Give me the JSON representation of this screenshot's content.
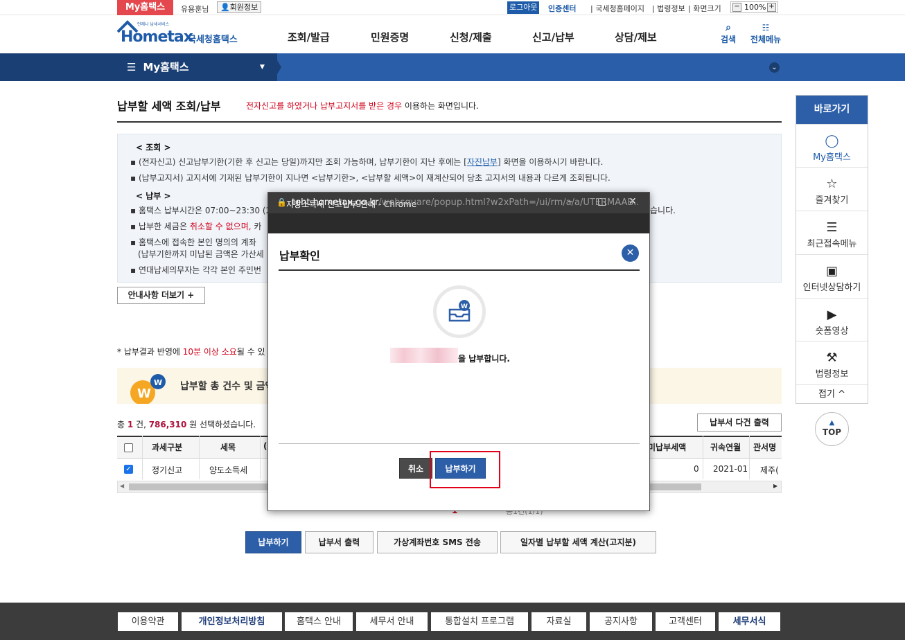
{
  "topbar": {
    "my_tab": "My홈택스",
    "user_greet": "유용훈님",
    "member_info": "회원정보",
    "logout": "로그아웃",
    "cert_center": "인증센터",
    "nts_page": "국세청홈페이지",
    "law_info": "법령정보",
    "screen_size": "화면크기",
    "zoom_value": "100%"
  },
  "header": {
    "logo_sub": "언제나 납세서비스",
    "logo_main": "Hometax",
    "logo_kr": "국세청홈택스",
    "gnb": [
      "조회/발급",
      "민원증명",
      "신청/제출",
      "신고/납부",
      "상담/제보"
    ],
    "search_label": "검색",
    "allmenu_label": "전체메뉴"
  },
  "navbar": {
    "title": "My홈택스"
  },
  "page": {
    "title": "납부할 세액 조회/납부",
    "subtitle_red": "전자신고를 하였거나 납부고지서를 받은 경우",
    "subtitle_rest": " 이용하는 화면입니다."
  },
  "info": {
    "head1": "< 조회 >",
    "line1a": "▪ (전자신고) 신고납부기한(기한 후 신고는 당일)까지만 조회 가능하며, 납부기한이 지난 후에는 [",
    "line1_link": "자진납부",
    "line1b": "] 화면을 이용하시기 바랍니다.",
    "line2": "▪ (납부고지서) 고지서에 기재된 납부기한이 지나면 <납부기한>, <납부할 세액>이 재계산되어 당초 고지서의 내용과 다르게 조회됩니다.",
    "head2": "< 납부 >",
    "line3": "▪ 홈택스 납부시간은 07:00~23:30 (22",
    "line3_tail": "습니다.",
    "line4a": "▪ 납부한 세금은 ",
    "line4_red": "취소할 수 없으며,",
    "line4b": " 카",
    "line5": "▪ 홈택스에 접속한 본인 명의의 계좌",
    "line6": "(납부기한까지 미납된 금액은 가산세",
    "line7": "▪ 연대납세의무자는 각각 본인 주민번"
  },
  "more_button": "안내사항 더보기 +",
  "note": {
    "pre": "* 납부결과 반영에 ",
    "red": "10분 이상 소요",
    "post": "될 수 있"
  },
  "summary": {
    "text": "납부할 총 건수 및 금액"
  },
  "count": {
    "pre": "총 ",
    "cnt": "1",
    "mid": " 건, ",
    "amt": "786,310",
    "post": " 원 선택하셨습니다."
  },
  "bulk_print": "납부서 다건 출력",
  "table": {
    "headers": [
      "과세구분",
      "세목",
      "(",
      "미납부세액",
      "귀속연월",
      "관서명"
    ],
    "row": {
      "type": "정기신고",
      "tax": "양도소득세",
      "unpaid": "0",
      "period": "2021-01",
      "office": "제주("
    }
  },
  "pager": {
    "current": "1",
    "text": "총1건(1/1)"
  },
  "bottom_buttons": [
    "납부하기",
    "납부서 출력",
    "가상계좌번호 SMS 전송",
    "일자별 납부할 세액 계산(고지분)"
  ],
  "footer": [
    "이용약관",
    "개인정보처리방침",
    "홈택스 안내",
    "세무서 안내",
    "통합설치 프로그램",
    "자료실",
    "공지사항",
    "고객센터",
    "세무서식"
  ],
  "quick": {
    "head": "바로가기",
    "items": [
      "My홈택스",
      "즐겨찾기",
      "최근접속메뉴",
      "인터넷상담하기",
      "숏폼영상",
      "법령정보"
    ],
    "fold": "접기 ^",
    "top": "TOP"
  },
  "popup": {
    "window_title": "지방소득세 신고납부 안내 - Chrome",
    "url_host": "teht.hometax.go.kr",
    "url_path": "/websquare/popup.html?w2xPath=/ui/rm/a/a/UTERMAAB...",
    "heading": "납부확인",
    "message": "을 납부합니다.",
    "cancel": "취소",
    "pay": "납부하기"
  },
  "colors": {
    "brand_blue": "#2d5fa8",
    "nav_dark": "#1a3f74",
    "accent_red": "#e4474d",
    "highlight": "#e0001a"
  }
}
